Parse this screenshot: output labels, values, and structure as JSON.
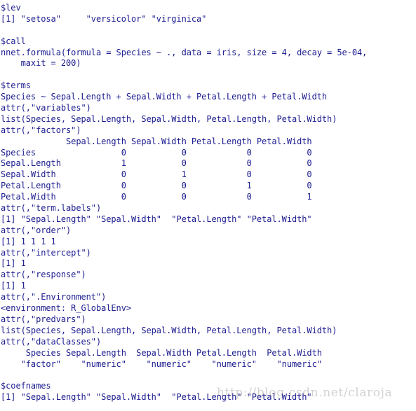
{
  "terminal": {
    "background_color": "#ffffff",
    "text_color": "#1b1b8f",
    "lines": [
      "$lev",
      "[1] \"setosa\"     \"versicolor\" \"virginica\" ",
      "",
      "$call",
      "nnet.formula(formula = Species ~ ., data = iris, size = 4, decay = 5e-04, ",
      "    maxit = 200)",
      "",
      "$terms",
      "Species ~ Sepal.Length + Sepal.Width + Petal.Length + Petal.Width",
      "attr(,\"variables\")",
      "list(Species, Sepal.Length, Sepal.Width, Petal.Length, Petal.Width)",
      "attr(,\"factors\")",
      "             Sepal.Length Sepal.Width Petal.Length Petal.Width",
      "Species                 0           0            0           0",
      "Sepal.Length            1           0            0           0",
      "Sepal.Width             0           1            0           0",
      "Petal.Length            0           0            1           0",
      "Petal.Width             0           0            0           1",
      "attr(,\"term.labels\")",
      "[1] \"Sepal.Length\" \"Sepal.Width\"  \"Petal.Length\" \"Petal.Width\" ",
      "attr(,\"order\")",
      "[1] 1 1 1 1",
      "attr(,\"intercept\")",
      "[1] 1",
      "attr(,\"response\")",
      "[1] 1",
      "attr(,\".Environment\")",
      "<environment: R_GlobalEnv>",
      "attr(,\"predvars\")",
      "list(Species, Sepal.Length, Sepal.Width, Petal.Length, Petal.Width)",
      "attr(,\"dataClasses\")",
      "     Species Sepal.Length  Sepal.Width Petal.Length  Petal.Width ",
      "    \"factor\"    \"numeric\"    \"numeric\"    \"numeric\"    \"numeric\" ",
      "",
      "$coefnames",
      "[1] \"Sepal.Length\" \"Sepal.Width\"  \"Petal.Length\" \"Petal.Width\" "
    ]
  },
  "watermark": {
    "text": "http://blog.csdn.net/claroja",
    "color": "#d2d2d2"
  }
}
